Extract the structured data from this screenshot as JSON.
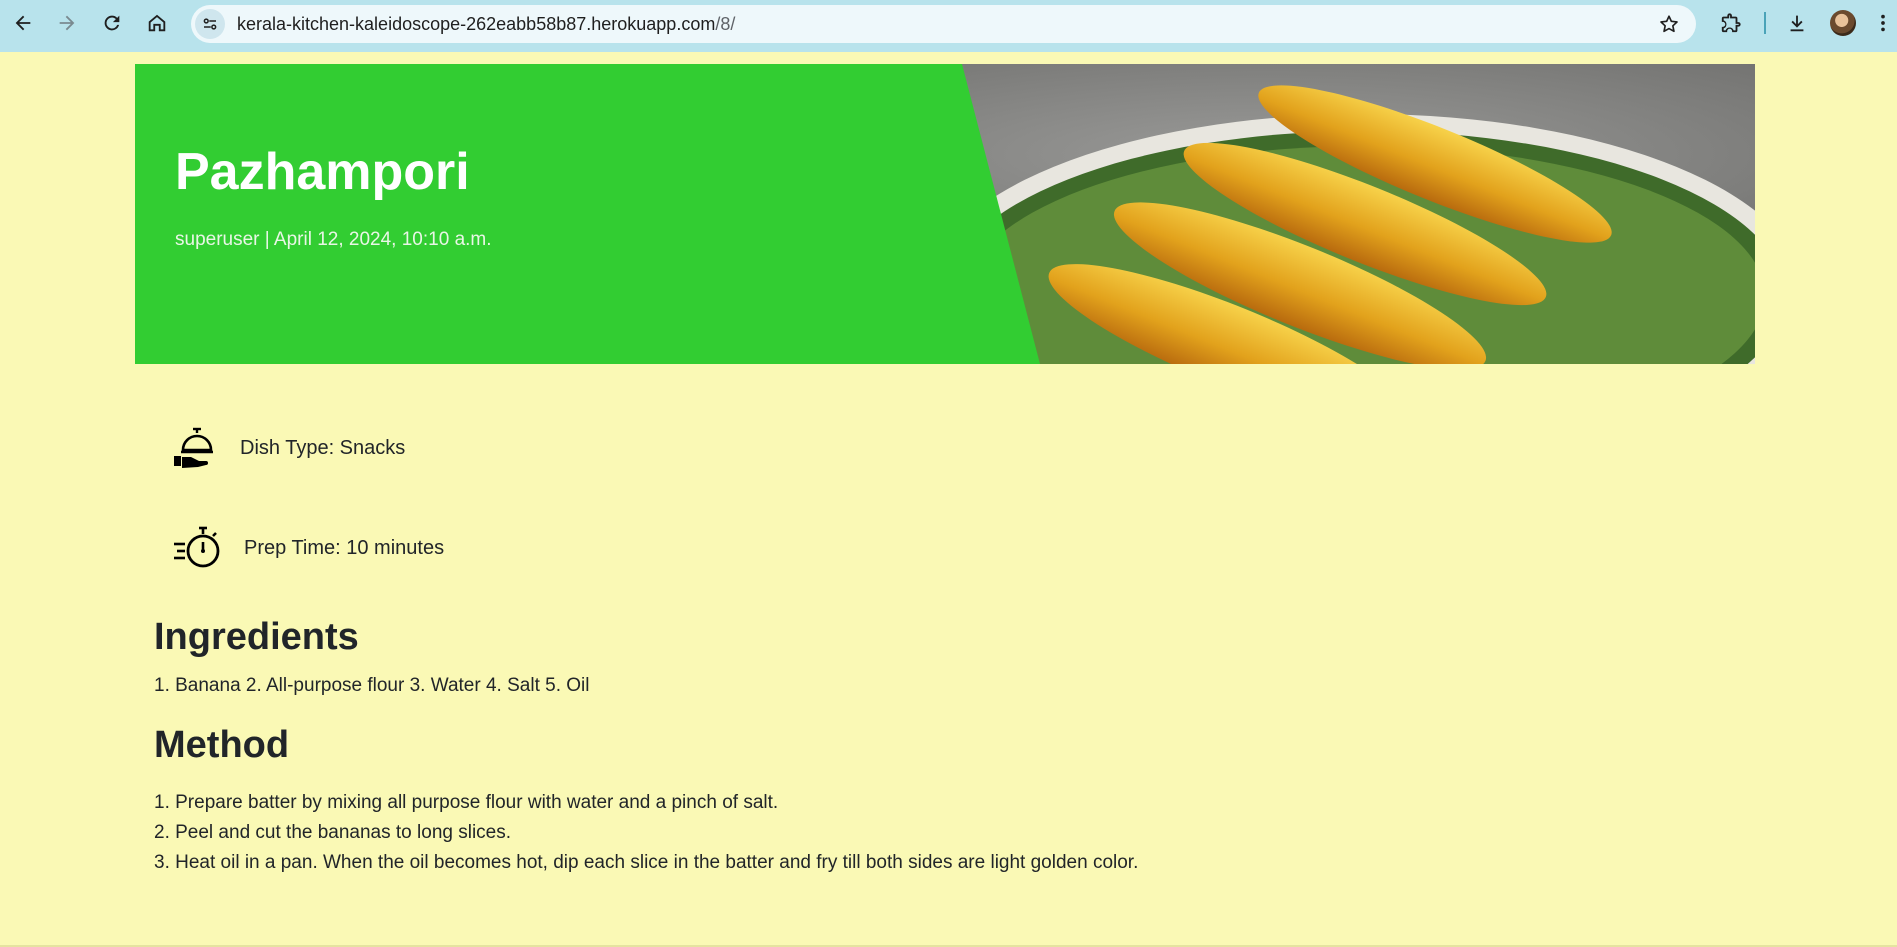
{
  "browser": {
    "url_host": "kerala-kitchen-kaleidoscope-262eabb58b87.herokuapp.com",
    "url_path": "/8/"
  },
  "recipe": {
    "title": "Pazhampori",
    "meta": "superuser | April 12, 2024, 10:10 a.m.",
    "dish_type": "Dish Type: Snacks",
    "prep_time": "Prep Time: 10 minutes",
    "ingredients_heading": "Ingredients",
    "ingredients_text": "1. Banana 2. All-purpose flour 3. Water 4. Salt 5. Oil",
    "method_heading": "Method",
    "method_steps": [
      "1. Prepare batter by mixing all purpose flour with water and a pinch of salt.",
      "2. Peel and cut the bananas to long slices.",
      "3. Heat oil in a pan. When the oil becomes hot, dip each slice in the batter and fry till both sides are light golden color."
    ]
  },
  "icons": {
    "back": "arrow-left-icon",
    "forward": "arrow-right-icon",
    "reload": "reload-icon",
    "home": "home-icon",
    "site_info": "tune-icon",
    "bookmark": "star-icon",
    "extensions": "puzzle-icon",
    "downloads": "download-icon",
    "menu": "kebab-menu-icon",
    "dish_type": "serving-cloche-icon",
    "prep_time": "stopwatch-icon"
  },
  "colors": {
    "chrome_bg": "#b8e3ec",
    "page_bg": "#faf9b5",
    "hero_green": "#32cd32",
    "text": "#212529"
  }
}
